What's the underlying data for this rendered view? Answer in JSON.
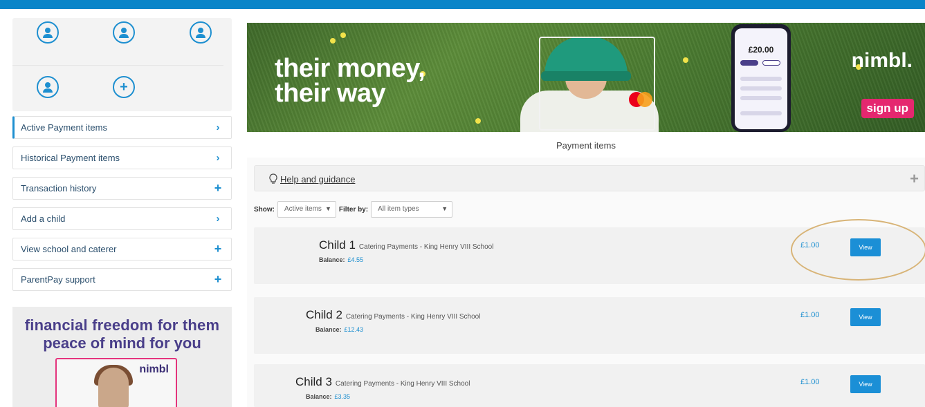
{
  "sidebar": {
    "children_avatars": [
      "avatar",
      "avatar",
      "avatar",
      "avatar"
    ],
    "add_child_symbol": "+",
    "menu": [
      {
        "label": "Active Payment items",
        "icon": "chevron-right-icon",
        "active": true
      },
      {
        "label": "Historical Payment items",
        "icon": "chevron-right-icon"
      },
      {
        "label": "Transaction history",
        "icon": "plus-icon"
      },
      {
        "label": "Add a child",
        "icon": "chevron-right-icon"
      },
      {
        "label": "View school and caterer",
        "icon": "plus-icon"
      },
      {
        "label": "ParentPay support",
        "icon": "plus-icon"
      }
    ],
    "promo": {
      "line1": "financial freedom for them",
      "line2": "peace of mind for you",
      "brand": "nimbl"
    }
  },
  "banner": {
    "headline_1": "their money,",
    "headline_2": "their way",
    "phone_amount": "£20.00",
    "brand": "nimbl.",
    "signup": "sign up"
  },
  "main": {
    "title": "Payment items",
    "help_label": "Help and guidance",
    "filters": {
      "show_label": "Show:",
      "show_value": "Active items",
      "filter_label": "Filter by:",
      "filter_value": "All item types"
    },
    "items": [
      {
        "child": "Child 1",
        "description": "Catering Payments - King Henry VIII School",
        "balance_label": "Balance:",
        "balance": "£4.55",
        "price": "£1.00",
        "action": "View"
      },
      {
        "child": "Child 2",
        "description": "Catering Payments - King Henry VIII School",
        "balance_label": "Balance:",
        "balance": "£12.43",
        "price": "£1.00",
        "action": "View"
      },
      {
        "child": "Child 3",
        "description": "Catering Payments - King Henry VIII School",
        "balance_label": "Balance:",
        "balance": "£3.35",
        "price": "£1.00",
        "action": "View"
      }
    ]
  },
  "colors": {
    "accent": "#1d8fd0",
    "topbar": "#0a85c9",
    "promo_text": "#4a3f8a",
    "signup": "#e5276f",
    "highlight_circle": "#d8b477"
  }
}
